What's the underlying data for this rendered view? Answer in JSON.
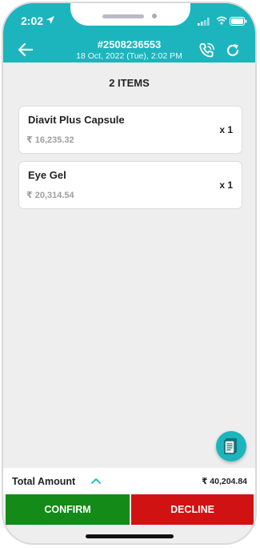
{
  "status_bar": {
    "time": "2:02"
  },
  "header": {
    "order_number": "#2508236553",
    "order_date": "18 Oct, 2022 (Tue),  2:02 PM"
  },
  "items_title": "2 ITEMS",
  "items": [
    {
      "name": "Diavit Plus Capsule",
      "price": "₹ 16,235.32",
      "quantity": "x 1"
    },
    {
      "name": "Eye Gel",
      "price": "₹ 20,314.54",
      "quantity": "x 1"
    }
  ],
  "total": {
    "label": "Total Amount",
    "amount": "₹ 40,204.84"
  },
  "actions": {
    "confirm_label": "CONFIRM",
    "decline_label": "DECLINE"
  },
  "colors": {
    "header": "#1cb5bd",
    "confirm": "#148a18",
    "decline": "#d11212",
    "background": "#eeeeee"
  }
}
